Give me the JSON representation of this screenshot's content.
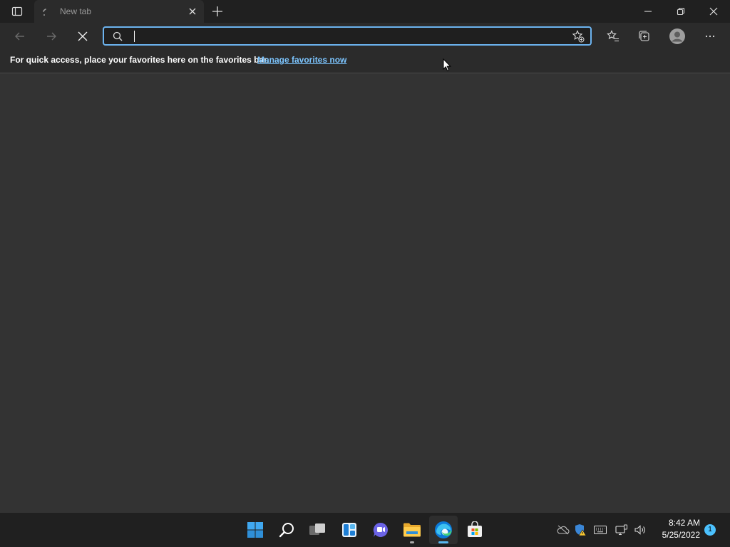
{
  "browser": {
    "tab": {
      "title": "New tab"
    },
    "address_bar": {
      "value": "",
      "placeholder": ""
    },
    "favorites_bar": {
      "message": "For quick access, place your favorites here on the favorites bar.",
      "link": "Manage favorites now"
    }
  },
  "taskbar": {
    "apps": [
      {
        "name": "start",
        "icon": "windows-logo-icon"
      },
      {
        "name": "search",
        "icon": "search-icon"
      },
      {
        "name": "task-view",
        "icon": "task-view-icon"
      },
      {
        "name": "widgets",
        "icon": "widgets-icon"
      },
      {
        "name": "chat",
        "icon": "teams-chat-icon"
      },
      {
        "name": "file-explorer",
        "icon": "folder-icon"
      },
      {
        "name": "edge",
        "icon": "edge-icon",
        "active": true
      },
      {
        "name": "store",
        "icon": "store-icon"
      }
    ],
    "clock": {
      "time": "8:42 AM",
      "date": "5/25/2022"
    },
    "notification_count": "1"
  },
  "colors": {
    "accent": "#6cb3ef",
    "link": "#7cc5ff",
    "page_bg": "#333333",
    "titlebar_bg": "#202020",
    "toolbar_bg": "#2b2b2b"
  }
}
